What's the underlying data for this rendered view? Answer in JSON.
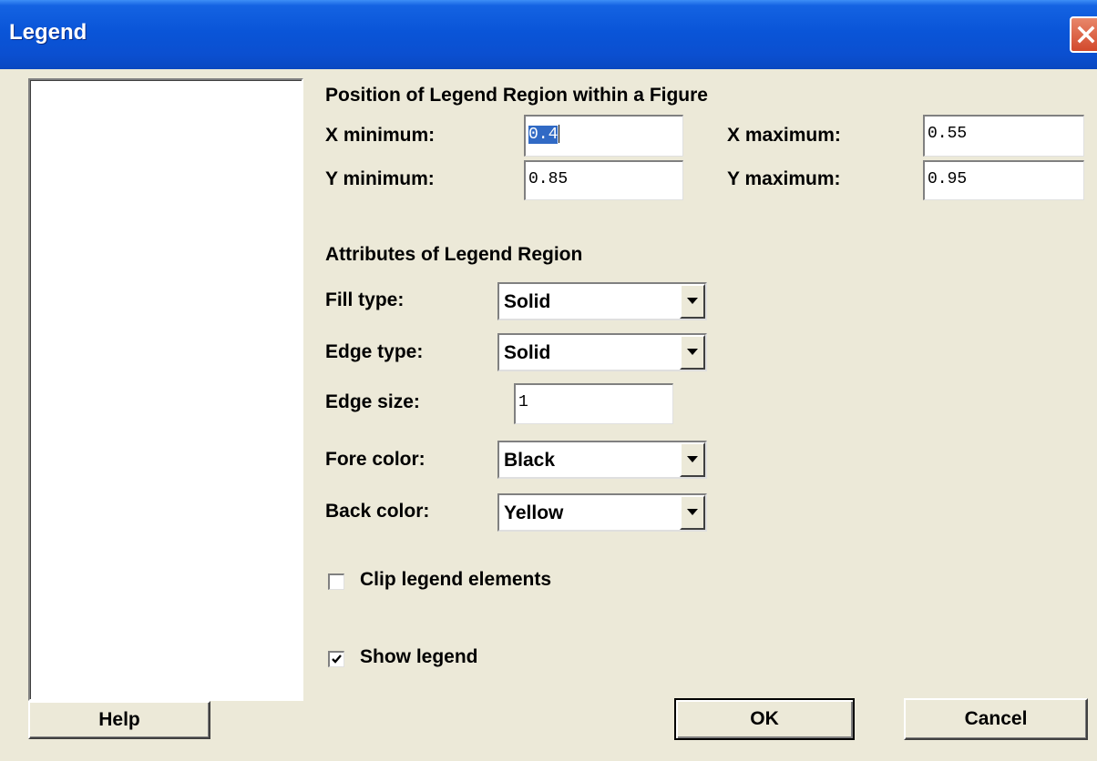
{
  "window": {
    "title": "Legend"
  },
  "position_section": {
    "heading": "Position of Legend Region within a Figure",
    "x_min_label": "X minimum:",
    "x_min_selected": "0.4",
    "x_max_label": "X maximum:",
    "x_max_value": "0.55",
    "y_min_label": "Y minimum:",
    "y_min_value": "0.85",
    "y_max_label": "Y maximum:",
    "y_max_value": "0.95"
  },
  "attributes_section": {
    "heading": "Attributes of Legend Region",
    "fill_type_label": "Fill type:",
    "fill_type_value": "Solid",
    "edge_type_label": "Edge type:",
    "edge_type_value": "Solid",
    "edge_size_label": "Edge size:",
    "edge_size_value": "1",
    "fore_color_label": "Fore color:",
    "fore_color_value": "Black",
    "back_color_label": "Back color:",
    "back_color_value": "Yellow"
  },
  "options": {
    "clip_label": "Clip legend elements",
    "clip_checked": false,
    "show_label": "Show legend",
    "show_checked": true
  },
  "buttons": {
    "help": "Help",
    "ok": "OK",
    "cancel": "Cancel"
  },
  "colors": {
    "titlebar": "#0a55d8",
    "dialog_bg": "#ece9d8",
    "selection": "#316ac5",
    "close_button": "#d2492c"
  },
  "icons": {
    "close": "close-icon",
    "dropdown": "chevron-down-icon",
    "check": "checkmark-icon"
  }
}
